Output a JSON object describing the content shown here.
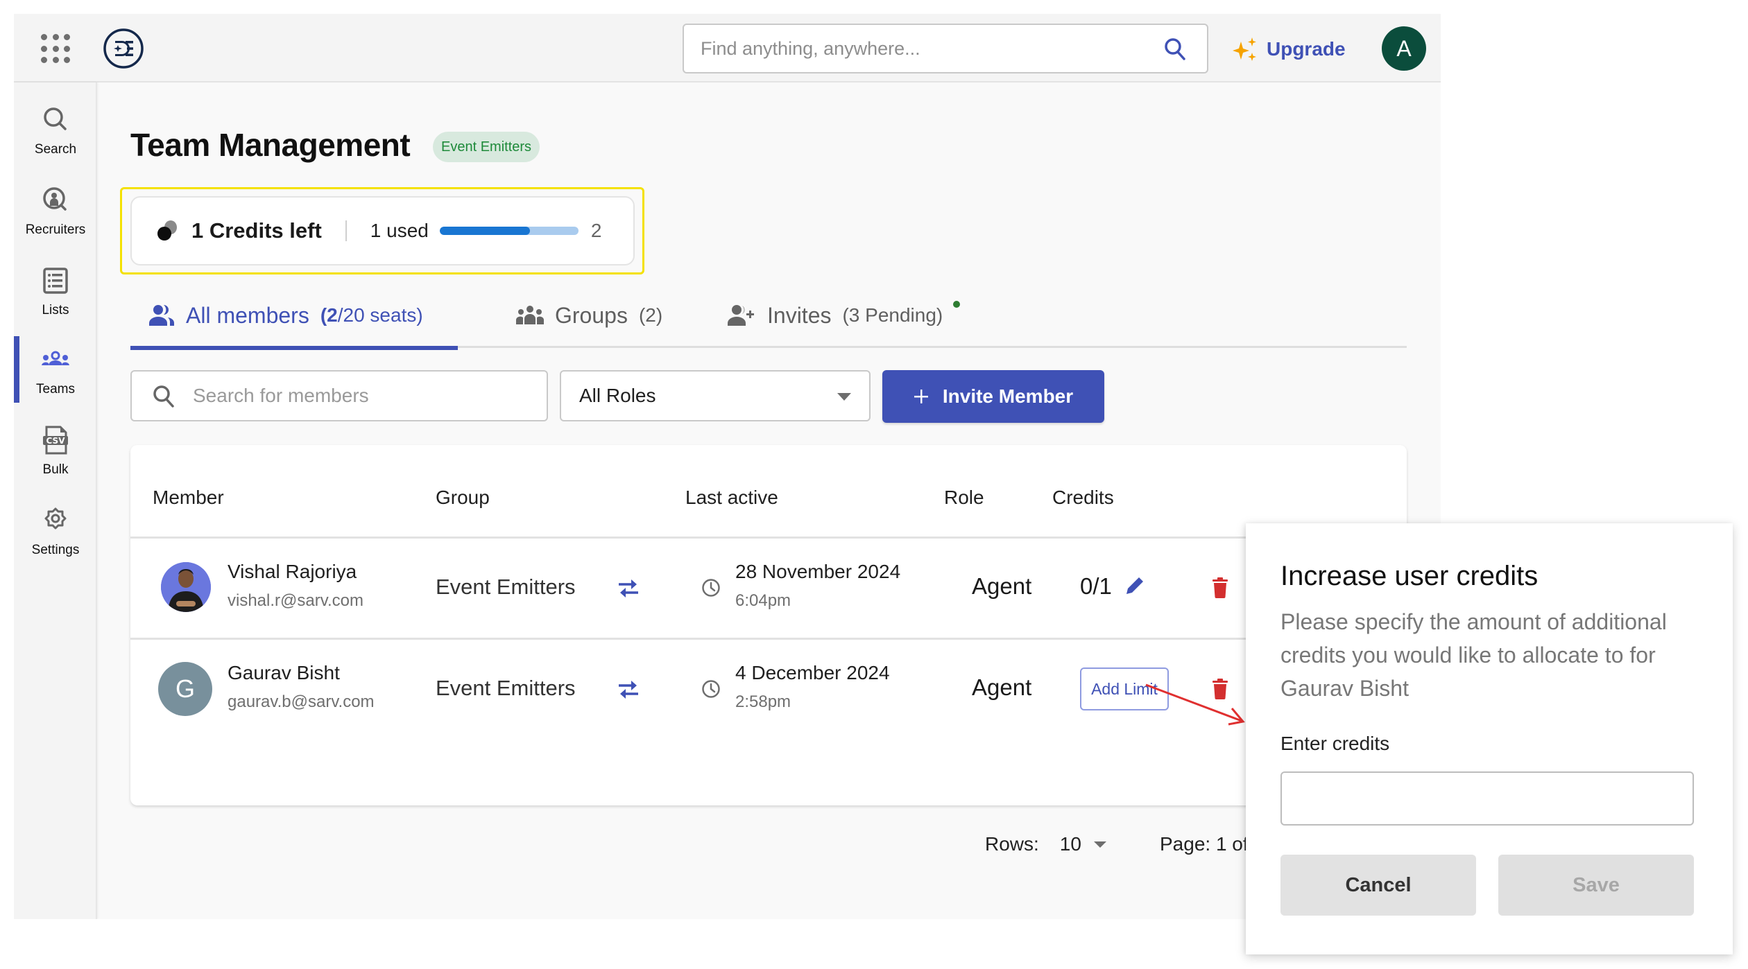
{
  "header": {
    "search_placeholder": "Find anything, anywhere...",
    "upgrade_label": "Upgrade",
    "avatar_initial": "A",
    "brand_color": "#3f51b5"
  },
  "sidebar": {
    "items": [
      {
        "label": "Search",
        "icon": "search-icon",
        "active": false
      },
      {
        "label": "Recruiters",
        "icon": "recruiter-search-icon",
        "active": false
      },
      {
        "label": "Lists",
        "icon": "list-icon",
        "active": false
      },
      {
        "label": "Teams",
        "icon": "teams-icon",
        "active": true
      },
      {
        "label": "Bulk",
        "icon": "csv-file-icon",
        "active": false
      },
      {
        "label": "Settings",
        "icon": "gear-icon",
        "active": false
      }
    ]
  },
  "page": {
    "title": "Team Management",
    "team_badge": "Event Emitters"
  },
  "credits": {
    "left_label": "1 Credits left",
    "used_label": "1 used",
    "used": 1,
    "total": 2,
    "total_label": "2",
    "progress_fraction": 0.65
  },
  "tabs": [
    {
      "label": "All members",
      "count_strong": "(2",
      "count_rest": "/20 seats)",
      "active": true
    },
    {
      "label": "Groups",
      "count": "(2)",
      "active": false
    },
    {
      "label": "Invites",
      "count": "(3 Pending)",
      "active": false,
      "has_dot": true
    }
  ],
  "filters": {
    "member_search_placeholder": "Search for members",
    "roles_value": "All Roles",
    "invite_label": "Invite Member"
  },
  "table": {
    "columns": [
      "Member",
      "Group",
      "Last active",
      "Role",
      "Credits"
    ],
    "rows": [
      {
        "name": "Vishal Rajoriya",
        "email": "vishal.r@sarv.com",
        "avatar": "photo",
        "group": "Event Emitters",
        "date": "28 November 2024",
        "time": "6:04pm",
        "role": "Agent",
        "credits": "0/1",
        "remove_label": "Remove"
      },
      {
        "name": "Gaurav Bisht",
        "email": "gaurav.b@sarv.com",
        "avatar": "G",
        "group": "Event Emitters",
        "date": "4 December 2024",
        "time": "2:58pm",
        "role": "Agent",
        "credits_button": "Add Limit",
        "remove_label": "Remove"
      }
    ]
  },
  "pagination": {
    "rows_label": "Rows:",
    "rows_value": "10",
    "page_label": "Page: 1 of"
  },
  "modal": {
    "title": "Increase user credits",
    "description": "Please specify the amount of additional credits you would like to allocate to for Gaurav Bisht",
    "input_label": "Enter credits",
    "input_value": "",
    "cancel_label": "Cancel",
    "save_label": "Save"
  }
}
